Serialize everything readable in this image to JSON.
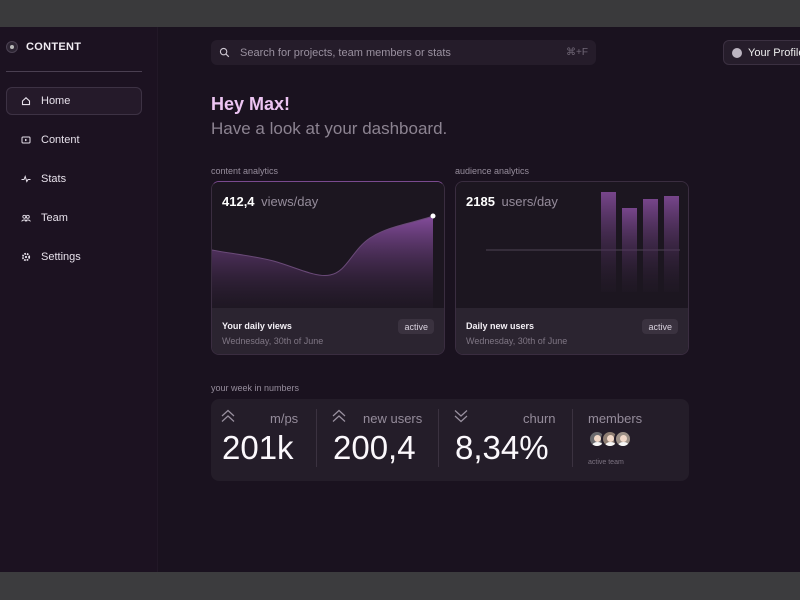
{
  "sidebar": {
    "brand": "CONTENT",
    "items": [
      {
        "label": "Home",
        "icon": "home-icon",
        "active": true
      },
      {
        "label": "Content",
        "icon": "video-icon",
        "active": false
      },
      {
        "label": "Stats",
        "icon": "pulse-icon",
        "active": false
      },
      {
        "label": "Team",
        "icon": "team-icon",
        "active": false
      },
      {
        "label": "Settings",
        "icon": "gear-icon",
        "active": false
      }
    ]
  },
  "header": {
    "search_placeholder": "Search for projects, team members or stats",
    "search_shortcut": "⌘+F",
    "profile_label": "Your Profile"
  },
  "greeting": {
    "title": "Hey Max!",
    "subtitle": "Have a look at your dashboard."
  },
  "content_analytics": {
    "section_label": "content analytics",
    "value": "412,4",
    "unit": "views/day",
    "footer_title": "Your daily views",
    "footer_date": "Wednesday, 30th of June",
    "badge": "active"
  },
  "audience_analytics": {
    "section_label": "audience analytics",
    "value": "2185",
    "unit": "users/day",
    "footer_title": "Daily new users",
    "footer_date": "Wednesday, 30th of June",
    "badge": "active"
  },
  "week": {
    "section_label": "your week in numbers",
    "stats": [
      {
        "label": "m/ps",
        "value": "201k",
        "trend": "up"
      },
      {
        "label": "new users",
        "value": "200,4",
        "trend": "up"
      },
      {
        "label": "churn",
        "value": "8,34%",
        "trend": "down"
      }
    ],
    "members_label": "members",
    "members_caption": "active team"
  },
  "colors": {
    "accent": "#ecc4f2",
    "chart_purple": "#7a4a8f",
    "background": "#1a121f"
  }
}
